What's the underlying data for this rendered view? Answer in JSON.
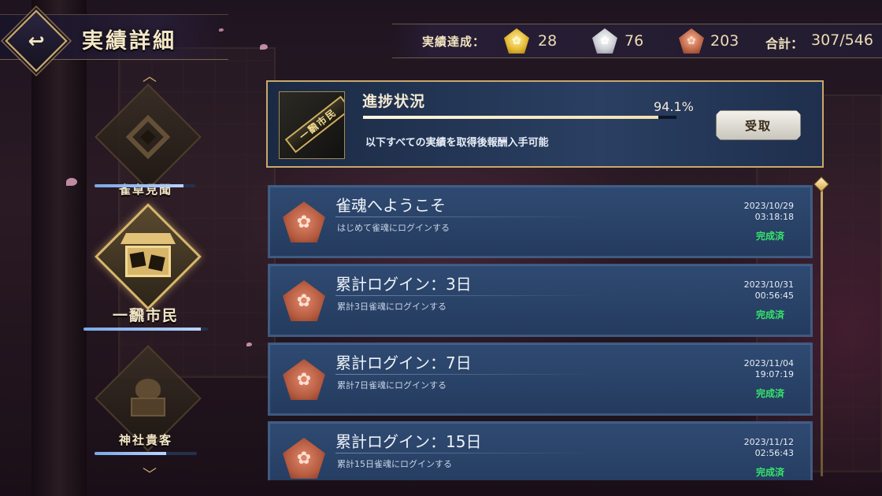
{
  "header": {
    "back_icon": "↩",
    "title": "実績詳細",
    "achieved_label": "実績達成：",
    "gold_count": "28",
    "silver_count": "76",
    "bronze_count": "203",
    "total_label": "合計：",
    "total_value": "307/546"
  },
  "categories": [
    {
      "name": "雀卓見聞",
      "progress": 0.88,
      "active": false
    },
    {
      "name": "一飜市民",
      "progress": 0.94,
      "active": true
    },
    {
      "name": "神社貴客",
      "progress": 0.7,
      "active": false
    }
  ],
  "summary": {
    "title": "進捗状況",
    "percent": "94.1%",
    "progress": 0.941,
    "description": "以下すべての実績を取得後報酬入手可能",
    "plaque_text": "一飜市民",
    "claim_label": "受取"
  },
  "achievements": [
    {
      "title": "雀魂へようこそ",
      "desc": "はじめて雀魂にログインする",
      "date": "2023/10/29",
      "time": "03:18:18",
      "status": "完成済"
    },
    {
      "title": "累計ログイン：3日",
      "desc": "累計3日雀魂にログインする",
      "date": "2023/10/31",
      "time": "00:56:45",
      "status": "完成済"
    },
    {
      "title": "累計ログイン：7日",
      "desc": "累計7日雀魂にログインする",
      "date": "2023/11/04",
      "time": "19:07:19",
      "status": "完成済"
    },
    {
      "title": "累計ログイン：15日",
      "desc": "累計15日雀魂にログインする",
      "date": "2023/11/12",
      "time": "02:56:43",
      "status": "完成済"
    }
  ],
  "colors": {
    "accent_gold": "#c9a96a",
    "panel_blue": "#2f4a72",
    "complete_green": "#37e46c"
  }
}
